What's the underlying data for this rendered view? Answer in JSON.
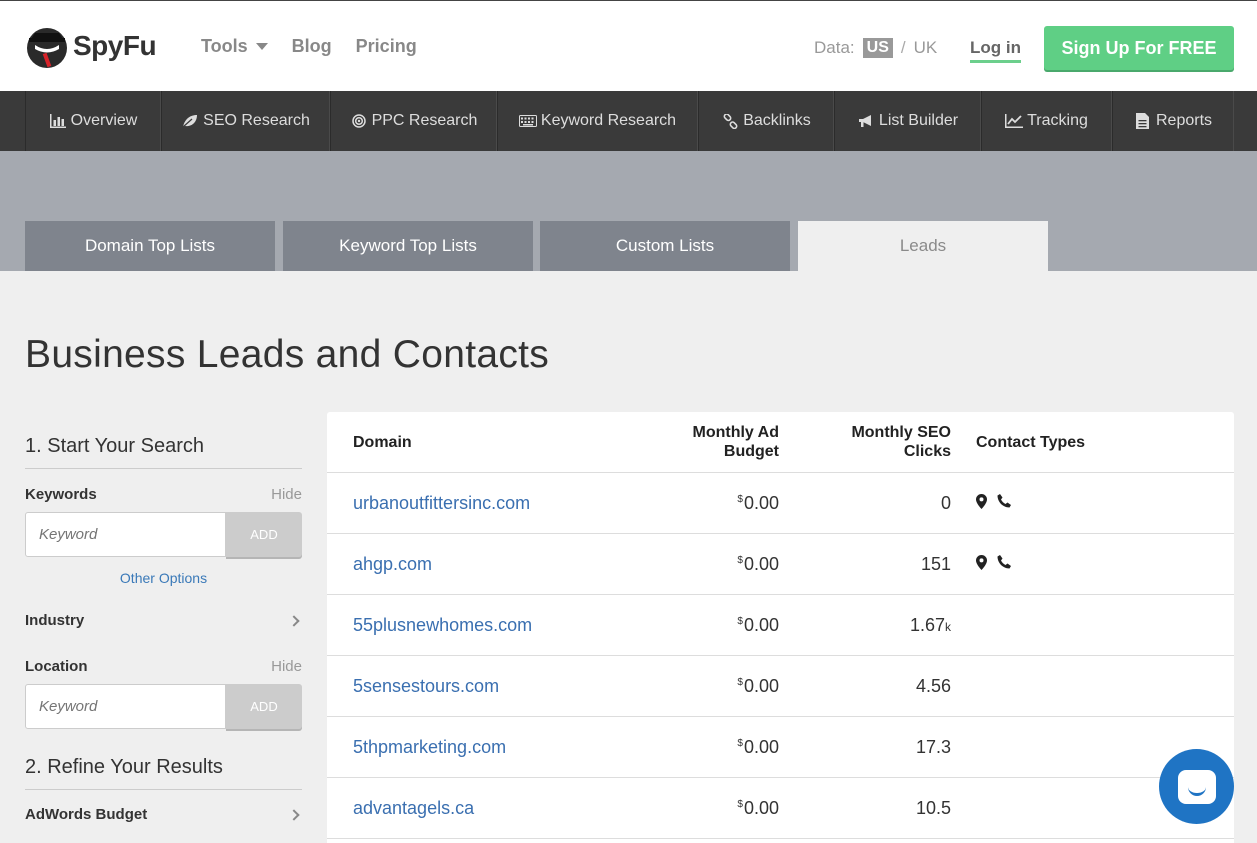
{
  "header": {
    "logo_text": "SpyFu",
    "nav": [
      {
        "label": "Tools",
        "has_dropdown": true
      },
      {
        "label": "Blog"
      },
      {
        "label": "Pricing"
      }
    ],
    "data_label": "Data:",
    "data_us": "US",
    "data_sep": "/",
    "data_uk": "UK",
    "login": "Log in",
    "signup": "Sign Up For FREE"
  },
  "darknav": [
    {
      "label": "Overview",
      "icon": "bar-chart-icon"
    },
    {
      "label": "SEO Research",
      "icon": "leaf-icon"
    },
    {
      "label": "PPC Research",
      "icon": "target-icon"
    },
    {
      "label": "Keyword Research",
      "icon": "keyboard-icon"
    },
    {
      "label": "Backlinks",
      "icon": "link-icon"
    },
    {
      "label": "List Builder",
      "icon": "megaphone-icon"
    },
    {
      "label": "Tracking",
      "icon": "line-chart-icon"
    },
    {
      "label": "Reports",
      "icon": "document-icon"
    }
  ],
  "tabs": [
    {
      "label": "Domain Top Lists"
    },
    {
      "label": "Keyword Top Lists"
    },
    {
      "label": "Custom Lists"
    },
    {
      "label": "Leads",
      "active": true
    }
  ],
  "page_title": "Business Leads and Contacts",
  "sidebar": {
    "section1": "1. Start Your Search",
    "keywords_label": "Keywords",
    "hide": "Hide",
    "keyword_placeholder": "Keyword",
    "add": "ADD",
    "other_options": "Other Options",
    "industry_label": "Industry",
    "location_label": "Location",
    "location_placeholder": "Keyword",
    "section2": "2. Refine Your Results",
    "adwords_label": "AdWords Budget"
  },
  "table": {
    "headers": {
      "domain": "Domain",
      "budget_line1": "Monthly Ad",
      "budget_line2": "Budget",
      "clicks_line1": "Monthly SEO",
      "clicks_line2": "Clicks",
      "contacts": "Contact Types"
    },
    "currency_symbol": "$",
    "rows": [
      {
        "domain": "urbanoutfittersinc.com",
        "budget": "0.00",
        "clicks": "0",
        "clicks_suffix": "",
        "contacts": [
          "map-marker-icon",
          "phone-icon"
        ]
      },
      {
        "domain": "ahgp.com",
        "budget": "0.00",
        "clicks": "151",
        "clicks_suffix": "",
        "contacts": [
          "map-marker-icon",
          "phone-icon"
        ]
      },
      {
        "domain": "55plusnewhomes.com",
        "budget": "0.00",
        "clicks": "1.67",
        "clicks_suffix": "k",
        "contacts": []
      },
      {
        "domain": "5sensestours.com",
        "budget": "0.00",
        "clicks": "4.56",
        "clicks_suffix": "",
        "contacts": []
      },
      {
        "domain": "5thpmarketing.com",
        "budget": "0.00",
        "clicks": "17.3",
        "clicks_suffix": "",
        "contacts": []
      },
      {
        "domain": "advantagels.ca",
        "budget": "0.00",
        "clicks": "10.5",
        "clicks_suffix": "",
        "contacts": []
      }
    ]
  },
  "colors": {
    "accent_green": "#5fcf85",
    "link_blue": "#3a6fb0",
    "chat_blue": "#1f74c4",
    "dark_nav": "#3a3a3a"
  }
}
